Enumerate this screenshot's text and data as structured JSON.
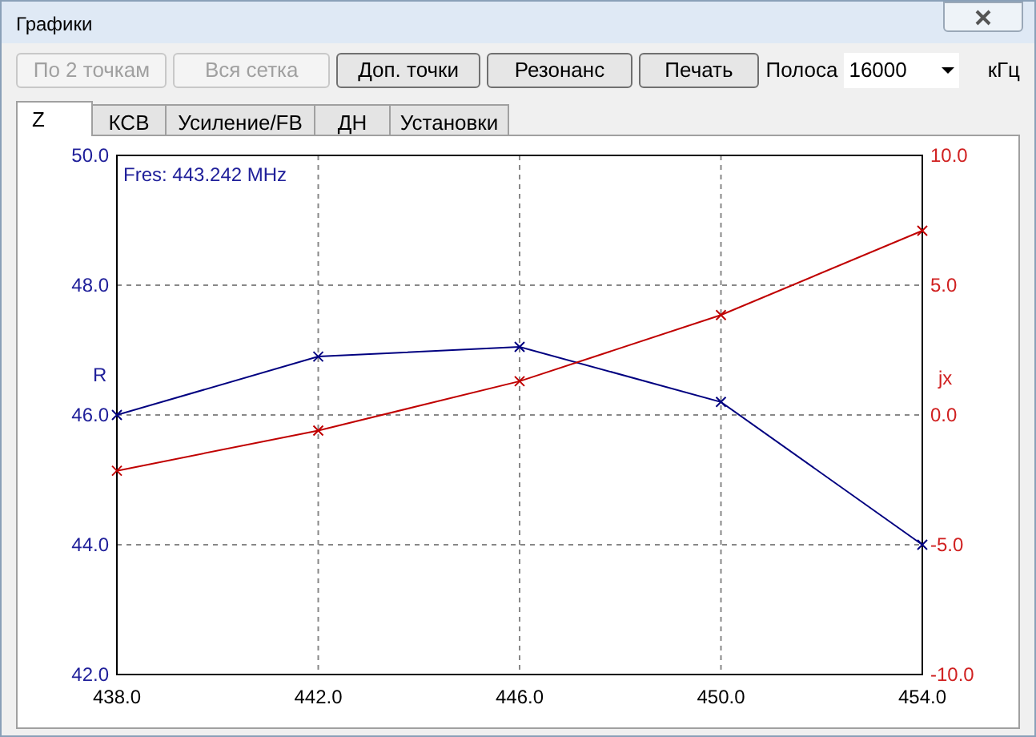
{
  "window": {
    "title": "Графики"
  },
  "toolbar": {
    "buttons": [
      {
        "label": "По 2 точкам",
        "disabled": true
      },
      {
        "label": "Вся сетка",
        "disabled": true
      },
      {
        "label": "Доп. точки",
        "disabled": false
      },
      {
        "label": "Резонанс",
        "disabled": false
      },
      {
        "label": "Печать",
        "disabled": false
      }
    ],
    "band": {
      "label": "Полоса",
      "value": "16000",
      "unit": "кГц"
    }
  },
  "tabs": [
    {
      "label": "Z",
      "selected": true
    },
    {
      "label": "КСВ",
      "selected": false
    },
    {
      "label": "Усиление/FB",
      "selected": false
    },
    {
      "label": "ДН",
      "selected": false
    },
    {
      "label": "Установки",
      "selected": false
    }
  ],
  "chart": {
    "annotation": "Fres: 443.242 MHz",
    "chart_data": {
      "type": "line",
      "grid": true,
      "x": [
        438,
        442,
        446,
        450,
        454
      ],
      "xlim": [
        438,
        454
      ],
      "xticks": [
        {
          "value": 438,
          "label": "438.0"
        },
        {
          "value": 442,
          "label": "442.0"
        },
        {
          "value": 446,
          "label": "446.0"
        },
        {
          "value": 450,
          "label": "450.0"
        },
        {
          "value": 454,
          "label": "454.0"
        }
      ],
      "ylim": [
        42,
        50
      ],
      "yticks": [
        {
          "value": 42,
          "label": "42.0"
        },
        {
          "value": 44,
          "label": "44.0"
        },
        {
          "value": 46,
          "label": "46.0"
        },
        {
          "value": 48,
          "label": "48.0"
        },
        {
          "value": 50,
          "label": "50.0"
        }
      ],
      "y2lim": [
        -10,
        10
      ],
      "y2ticks": [
        {
          "value": -10,
          "label": "-10.0"
        },
        {
          "value": -5,
          "label": "-5.0"
        },
        {
          "value": 0,
          "label": "0.0"
        },
        {
          "value": 5,
          "label": "5.0"
        },
        {
          "value": 10,
          "label": "10.0"
        }
      ],
      "series": [
        {
          "name": "R",
          "color": "#000080",
          "marker": "x",
          "values": [
            46.0,
            46.9,
            47.05,
            46.2,
            44.0
          ]
        },
        {
          "name": "jx",
          "color": "#c00000",
          "axis": "y2",
          "marker": "x",
          "values": [
            -2.15,
            -0.6,
            1.3,
            3.85,
            7.1
          ]
        }
      ]
    }
  }
}
